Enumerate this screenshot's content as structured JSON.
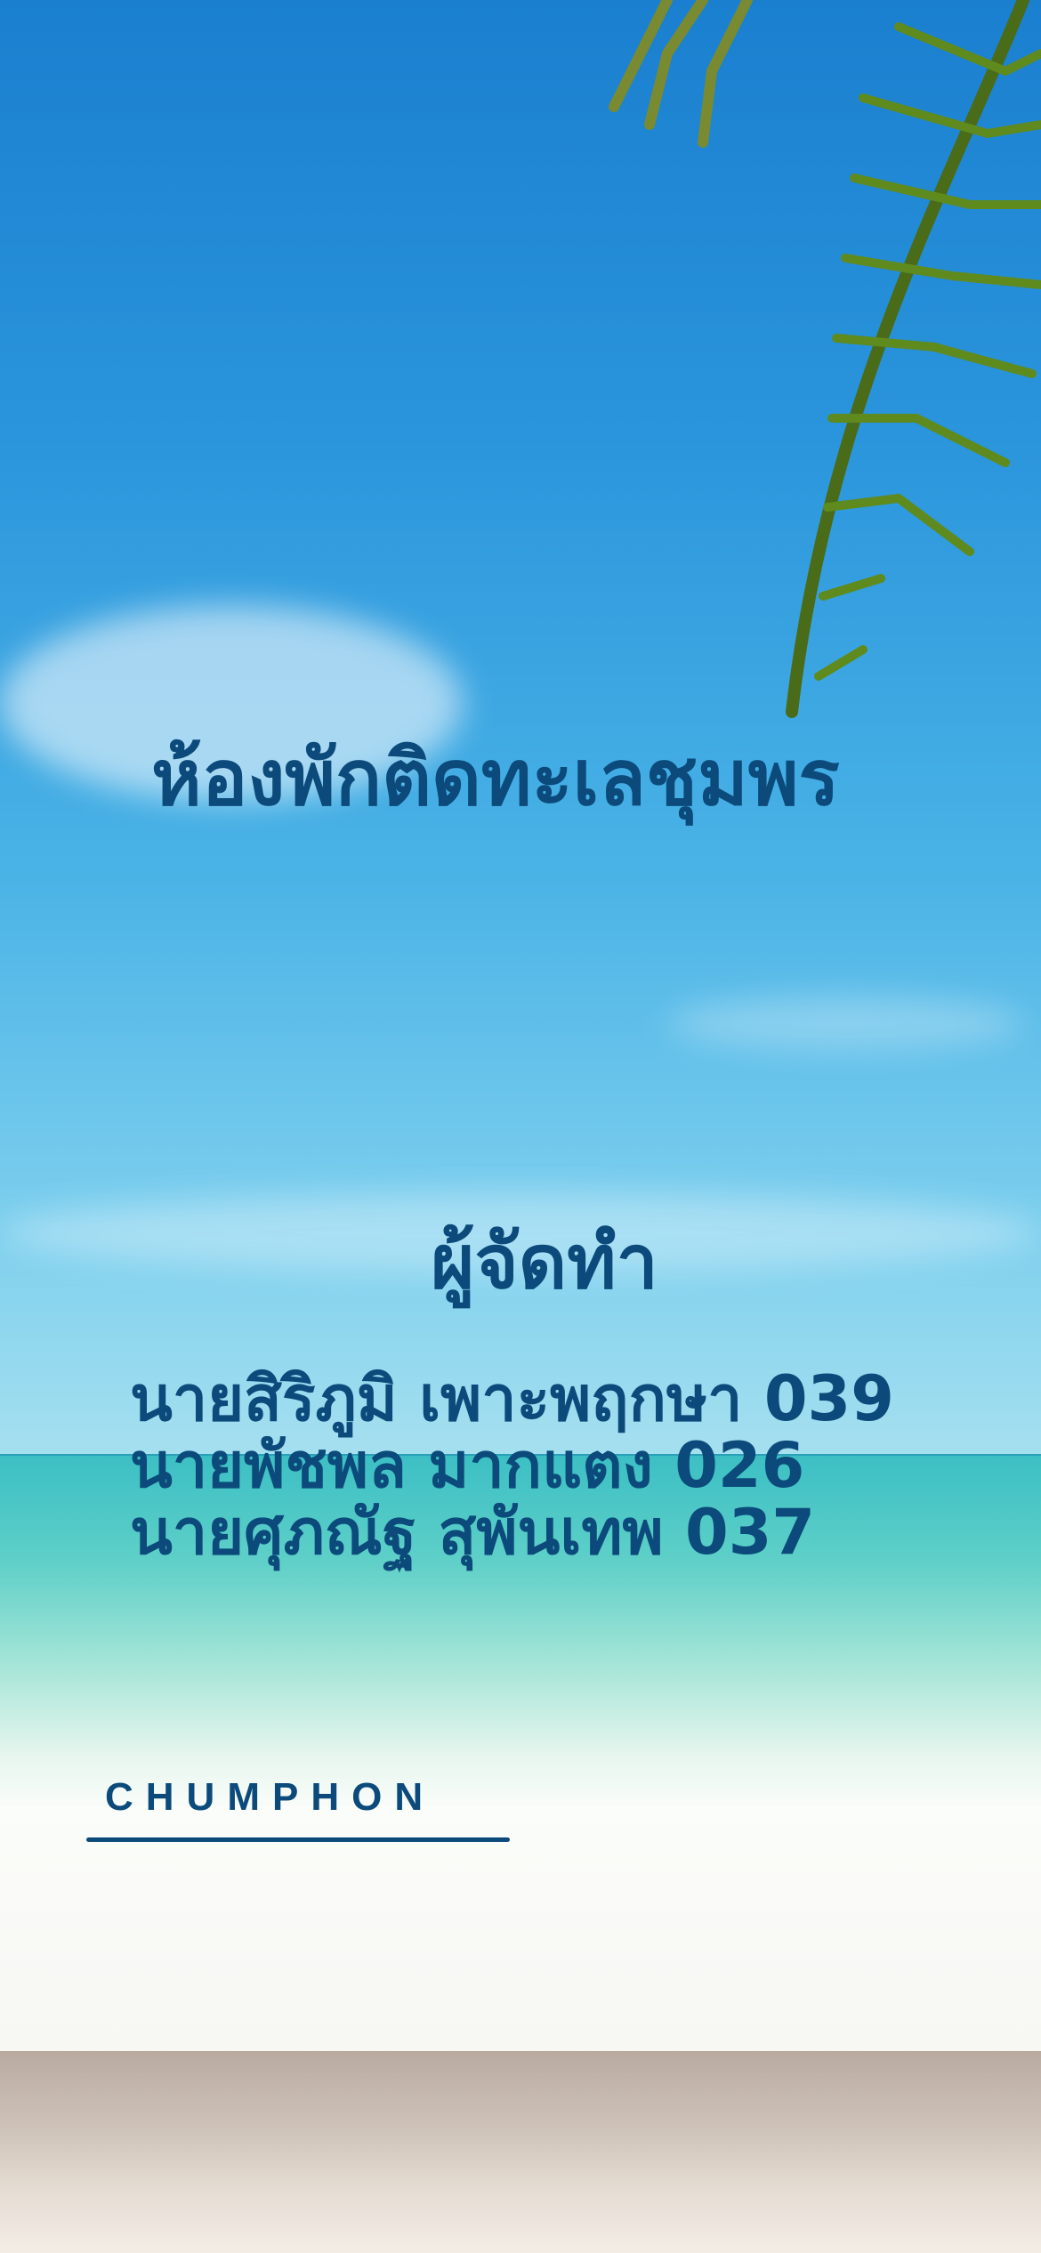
{
  "title": "ห้องพักติดทะเลชุมพร",
  "makers_heading": "ผู้จัดทำ",
  "makers": [
    "นายสิริภูมิ เพาะพฤกษา 039",
    "นายพัชพล มากแตง 026",
    "นายศุภณัฐ สุพันเทพ 037"
  ],
  "brand": "CHUMPHON",
  "colors": {
    "text": "#0b4a7a"
  }
}
